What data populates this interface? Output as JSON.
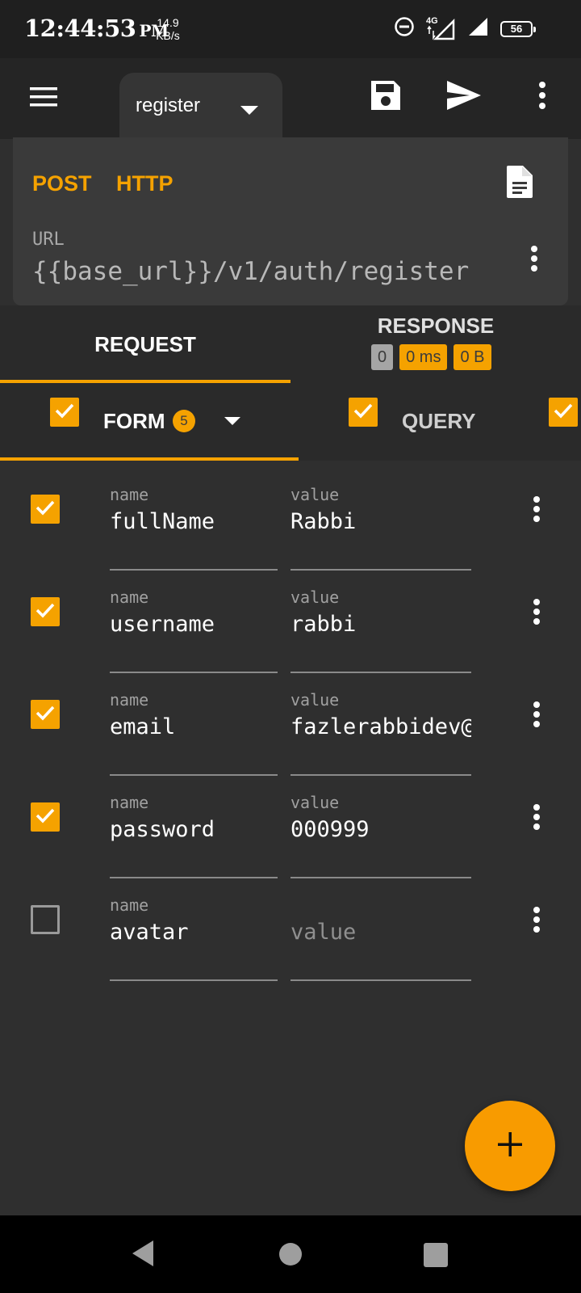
{
  "status_bar": {
    "time": "12:44:53",
    "ampm": "PM",
    "net_speed_value": "14.9",
    "net_speed_unit": "KB/s",
    "network_type": "4G",
    "battery_level": "56"
  },
  "app_bar": {
    "document_name": "register"
  },
  "request": {
    "method": "POST",
    "protocol": "HTTP",
    "url_label": "URL",
    "url": "{{base_url}}/v1/auth/register"
  },
  "tabs": {
    "request_label": "REQUEST",
    "response_label": "RESPONSE",
    "response_status": "0",
    "response_time": "0 ms",
    "response_size": "0 B"
  },
  "sub_tabs": {
    "form_label": "FORM",
    "form_count": "5",
    "query_label": "QUERY"
  },
  "params": [
    {
      "enabled": true,
      "name_label": "name",
      "name": "fullName",
      "value_label": "value",
      "value": "Rabbi"
    },
    {
      "enabled": true,
      "name_label": "name",
      "name": "username",
      "value_label": "value",
      "value": "rabbi"
    },
    {
      "enabled": true,
      "name_label": "name",
      "name": "email",
      "value_label": "value",
      "value": "fazlerabbidev@"
    },
    {
      "enabled": true,
      "name_label": "name",
      "name": "password",
      "value_label": "value",
      "value": "000999"
    },
    {
      "enabled": false,
      "name_label": "name",
      "name": "avatar",
      "value_label": "",
      "value": "value"
    }
  ],
  "colors": {
    "accent": "#f5a200",
    "background": "#2f2f2f",
    "card": "#3a3a3a"
  }
}
